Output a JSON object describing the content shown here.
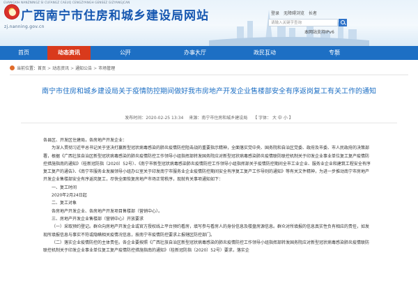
{
  "header": {
    "site_en": "GVANGXIH NANZNINGZ SI CUFANGZ CAEUQ CENGZYANGH GENSEZ GIZYANGJCAN",
    "site_title": "广西南宁市住房和城乡建设局网站",
    "site_url": "zj.nanning.gov.cn",
    "top_links": [
      "登录",
      "无障碍浏览",
      "长者"
    ],
    "search_placeholder": "请输入关键字查询",
    "ipv6_label": "本网站支持IPv6"
  },
  "nav": {
    "items": [
      "首页",
      "动态资讯",
      "公开",
      "办事大厅",
      "政民互动",
      "专题"
    ],
    "active_index": 1
  },
  "breadcrumb": {
    "items": [
      "当前位置：",
      "首页",
      "动态资讯",
      "通知公告",
      "市场管理"
    ]
  },
  "article": {
    "title": "南宁市住房和城乡建设局关于疫情防控期间做好我市房地产开发企业售楼部安全有序返岗复工有关工作的通知",
    "publish_time": "发布时间：2020-02-25 13:34",
    "source": "来源：南宁市住房和城乡建设局",
    "font_size_label": "【 字体： 大 中 小 】",
    "paragraphs": [
      "各县区、开发区住建局，各房地产开发企业：",
      "为深入贯彻习近平总书记关于坚决打赢新型冠状病毒感染的肺炎疫情防控阻击战的重要指示精神，全面落实党中央、国务院和自治区党委、政府及市委、市人民政府的决策部署，根据《广西壮族自治区新型冠状病毒感染的肺炎疫情防控工作领导小组指挥部转发国务院应对新型冠状病毒感染肺炎疫情联防联控机制关于印发企业事业单位复工复产疫情防控措施指南的通知》（桂新冠防指〔2020〕52号）、《南宁市新型冠状病毒感染肺炎疫情防控工作领导小组指挥部关于疫情防控期间全市工业企业、服务业企业和建筑工程安全有序复工复产的通告》、《南宁市服务业发展领导小组办公室关于印发南宁市服务业企业疫情防控期间安全有序复工复产工作导则的通知》等有关文件精神，为进一步推动南宁市房地产开发企业售楼部安全有序返岗复工，尽快全面恢复房地产市场正常秩序，现就有关事项通知如下：",
      "一、复工时间",
      "2020年2月24日起",
      "二、复工对象",
      "各房地产开发企业、各房地产开发项目售楼部（营销中心）。",
      "三、房地产开发企业售楼部（营销中心）开放要求",
      "（一）采取预约登记。群众向房地产开发企业或官方授权线上平台预约看房，填写参与看房人的身份信息及楼盘房源信息。群众对所填报的信息真实性负有相应的责任，如发现所填报信息与事实不符或隐瞒相关疫情况信息，按南宁市疫情防控要求上报辖区防控部门。",
      "（二）落实企业疫情防控的主体责任。各企业要按照《广西壮族自治区新型冠状病毒感染的肺炎疫情防控工作领导小组指挥部转发国务院应对新型冠状病毒感染肺炎疫情联防联控机制关于印发企业事业单位复工复产疫情防控措施指南的通知》（桂新冠防指〔2020〕52号）要求，落实企"
    ]
  }
}
